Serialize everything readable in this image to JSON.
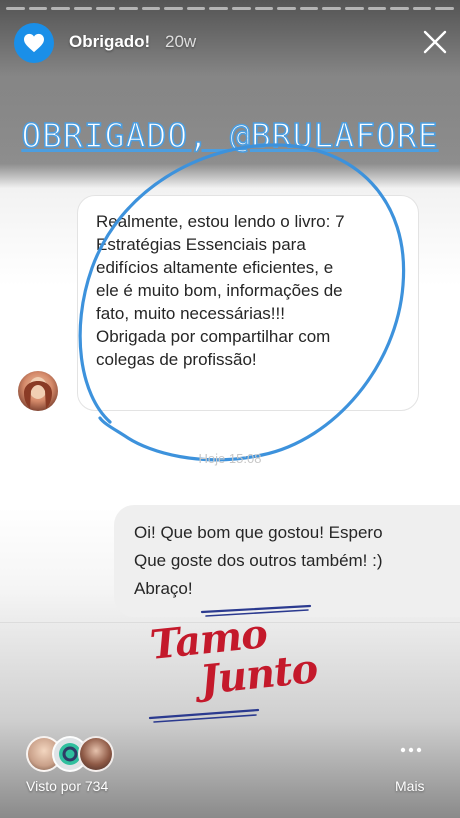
{
  "header": {
    "account_name": "Obrigado!",
    "time_ago": "20w",
    "avatar_icon": "heart-icon",
    "close_icon": "close-icon",
    "accent_color": "#1a8fe8"
  },
  "story": {
    "headline": "OBRIGADO, @BRULAFORE",
    "incoming_message": {
      "lines": [
        "Realmente, estou lendo o livro: 7",
        "Estratégias  Essenciais para",
        "edifícios altamente eficientes, e",
        "ele é muito bom, informações de",
        "fato, muito necessárias!!!",
        "Obrigada por compartilhar com",
        "colegas de profissão!"
      ]
    },
    "timestamp": "Hoje 15:08",
    "outgoing_message": {
      "lines": [
        "Oi! Que bom que gostou! Espero",
        "Que goste dos outros também! :)",
        "Abraço!"
      ]
    },
    "sticker": {
      "line1": "Tamo",
      "line2": "Junto",
      "color": "#c4192b"
    }
  },
  "footer": {
    "seen_by": "Visto por 734",
    "more_label": "Mais",
    "more_icon": "more-dots-icon"
  }
}
